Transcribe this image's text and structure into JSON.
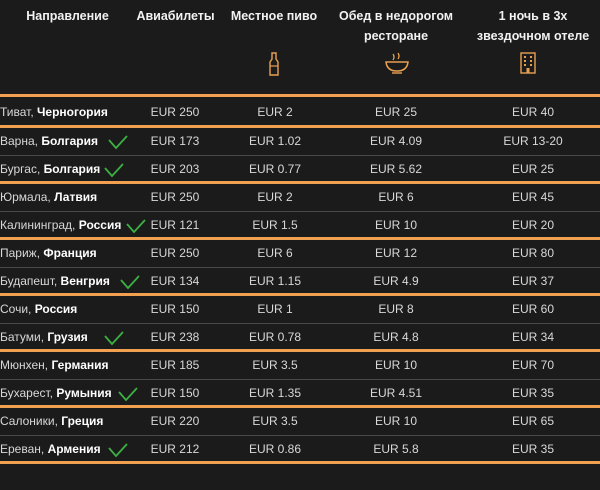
{
  "headers": {
    "destination": "Направление",
    "airfare": "Авиабилеты",
    "beer": "Местное пиво",
    "lunch_l1": "Обед в недорогом",
    "lunch_l2": "ресторане",
    "hotel_l1": "1 ночь в 3х",
    "hotel_l2": "звездочном отеле"
  },
  "icons": {
    "beer": "bottle-icon",
    "lunch": "bowl-icon",
    "hotel": "building-icon",
    "check": "checkmark-icon"
  },
  "colors": {
    "accent": "#f0a050",
    "check": "#3cb043"
  },
  "rows": [
    {
      "city": "Тиват, ",
      "country": "Черногория",
      "check": false,
      "air": "EUR 250",
      "beer": "EUR 2",
      "lunch": "EUR 25",
      "hotel": "EUR 40"
    },
    {
      "city": "Варна, ",
      "country": "Болгария",
      "check": true,
      "air": "EUR 173",
      "beer": "EUR 1.02",
      "lunch": "EUR 4.09",
      "hotel": "EUR 13-20"
    },
    {
      "city": "Бургас, ",
      "country": "Болгария",
      "check": true,
      "air": "EUR 203",
      "beer": "EUR 0.77",
      "lunch": "EUR 5.62",
      "hotel": "EUR 25"
    },
    {
      "city": "Юрмала, ",
      "country": "Латвия",
      "check": false,
      "air": "EUR 250",
      "beer": "EUR 2",
      "lunch": "EUR 6",
      "hotel": "EUR 45"
    },
    {
      "city": "Калининград, ",
      "country": "Россия",
      "check": true,
      "air": "EUR 121",
      "beer": "EUR 1.5",
      "lunch": "EUR 10",
      "hotel": "EUR 20"
    },
    {
      "city": "Париж, ",
      "country": "Франция",
      "check": false,
      "air": "EUR 250",
      "beer": "EUR 6",
      "lunch": "EUR 12",
      "hotel": "EUR 80"
    },
    {
      "city": "Будапешт, ",
      "country": "Венгрия",
      "check": true,
      "air": "EUR 134",
      "beer": "EUR 1.15",
      "lunch": "EUR 4.9",
      "hotel": "EUR 37"
    },
    {
      "city": "Сочи, ",
      "country": "Россия",
      "check": false,
      "air": "EUR 150",
      "beer": "EUR 1",
      "lunch": "EUR 8",
      "hotel": "EUR 60"
    },
    {
      "city": "Батуми, ",
      "country": "Грузия",
      "check": true,
      "air": "EUR 238",
      "beer": "EUR 0.78",
      "lunch": "EUR 4.8",
      "hotel": "EUR 34"
    },
    {
      "city": "Мюнхен, ",
      "country": "Германия",
      "check": false,
      "air": "EUR 185",
      "beer": "EUR 3.5",
      "lunch": "EUR 10",
      "hotel": "EUR 70"
    },
    {
      "city": "Бухарест, ",
      "country": "Румыния",
      "check": true,
      "air": "EUR 150",
      "beer": "EUR 1.35",
      "lunch": "EUR 4.51",
      "hotel": "EUR 35"
    },
    {
      "city": "Салоники, ",
      "country": "Греция",
      "check": false,
      "air": "EUR 220",
      "beer": "EUR 3.5",
      "lunch": "EUR 10",
      "hotel": "EUR 65"
    },
    {
      "city": "Ереван, ",
      "country": "Армения",
      "check": true,
      "air": "EUR 212",
      "beer": "EUR 0.86",
      "lunch": "EUR 5.8",
      "hotel": "EUR 35"
    }
  ]
}
